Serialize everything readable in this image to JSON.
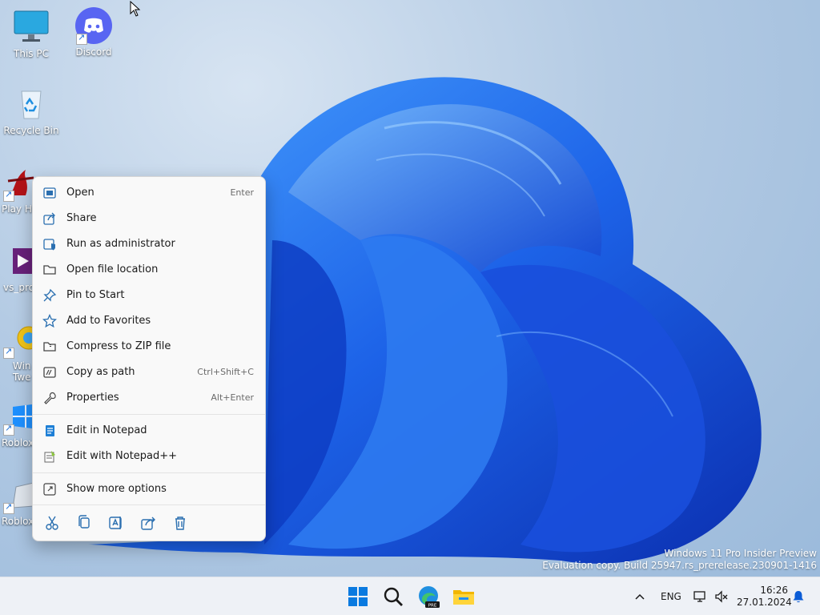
{
  "desktop": {
    "icons": [
      {
        "label": "This PC"
      },
      {
        "label": "Discord"
      },
      {
        "label": "Recycle Bin"
      },
      {
        "label": "Play Hi"
      },
      {
        "label": "vs_pro"
      },
      {
        "label": "Win Twe"
      },
      {
        "label": "Roblox"
      },
      {
        "label": "Roblox"
      }
    ]
  },
  "context_menu": {
    "items": [
      {
        "label": "Open",
        "shortcut": "Enter",
        "icon": "open-icon"
      },
      {
        "label": "Share",
        "shortcut": "",
        "icon": "share-icon"
      },
      {
        "label": "Run as administrator",
        "shortcut": "",
        "icon": "shield-icon"
      },
      {
        "label": "Open file location",
        "shortcut": "",
        "icon": "folder-icon"
      },
      {
        "label": "Pin to Start",
        "shortcut": "",
        "icon": "pin-icon"
      },
      {
        "label": "Add to Favorites",
        "shortcut": "",
        "icon": "star-icon"
      },
      {
        "label": "Compress to ZIP file",
        "shortcut": "",
        "icon": "zip-icon"
      },
      {
        "label": "Copy as path",
        "shortcut": "Ctrl+Shift+C",
        "icon": "copy-path-icon"
      },
      {
        "label": "Properties",
        "shortcut": "Alt+Enter",
        "icon": "wrench-icon"
      },
      {
        "label": "Edit in Notepad",
        "shortcut": "",
        "icon": "notepad-icon"
      },
      {
        "label": "Edit with Notepad++",
        "shortcut": "",
        "icon": "notepadpp-icon"
      },
      {
        "label": "Show more options",
        "shortcut": "",
        "icon": "more-options-icon"
      }
    ],
    "quick_actions": [
      "cut-icon",
      "copy-icon",
      "rename-icon",
      "share-icon",
      "delete-icon"
    ]
  },
  "watermark": {
    "line1": "Windows 11 Pro Insider Preview",
    "line2": "Evaluation copy. Build 25947.rs_prerelease.230901-1416"
  },
  "taskbar": {
    "pinned": [
      "start-icon",
      "search-icon",
      "edge-beta-icon",
      "file-explorer-icon"
    ],
    "tray": {
      "language": "ENG",
      "time": "16:26",
      "date": "27.01.2024"
    }
  },
  "colors": {
    "accent": "#0067c0",
    "wallpaper_blue": "#1e63e6"
  }
}
